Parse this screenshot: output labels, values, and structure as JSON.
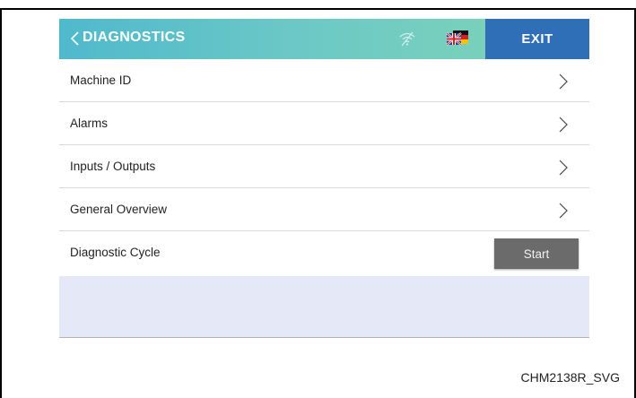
{
  "header": {
    "title": "DIAGNOSTICS",
    "exit_label": "EXIT",
    "back_icon": "chevron-left-icon",
    "wifi_icon": "wifi-off-icon",
    "language_icon": "flag-icon",
    "colors": {
      "header": "#5cc0c9",
      "exit": "#2f6fb7"
    }
  },
  "menu": {
    "items": [
      {
        "label": "Machine ID"
      },
      {
        "label": "Alarms"
      },
      {
        "label": "Inputs / Outputs"
      },
      {
        "label": "General Overview"
      }
    ],
    "diagnostic_cycle": {
      "label": "Diagnostic Cycle",
      "button": "Start"
    }
  },
  "figure_code": "CHM2138R_SVG"
}
